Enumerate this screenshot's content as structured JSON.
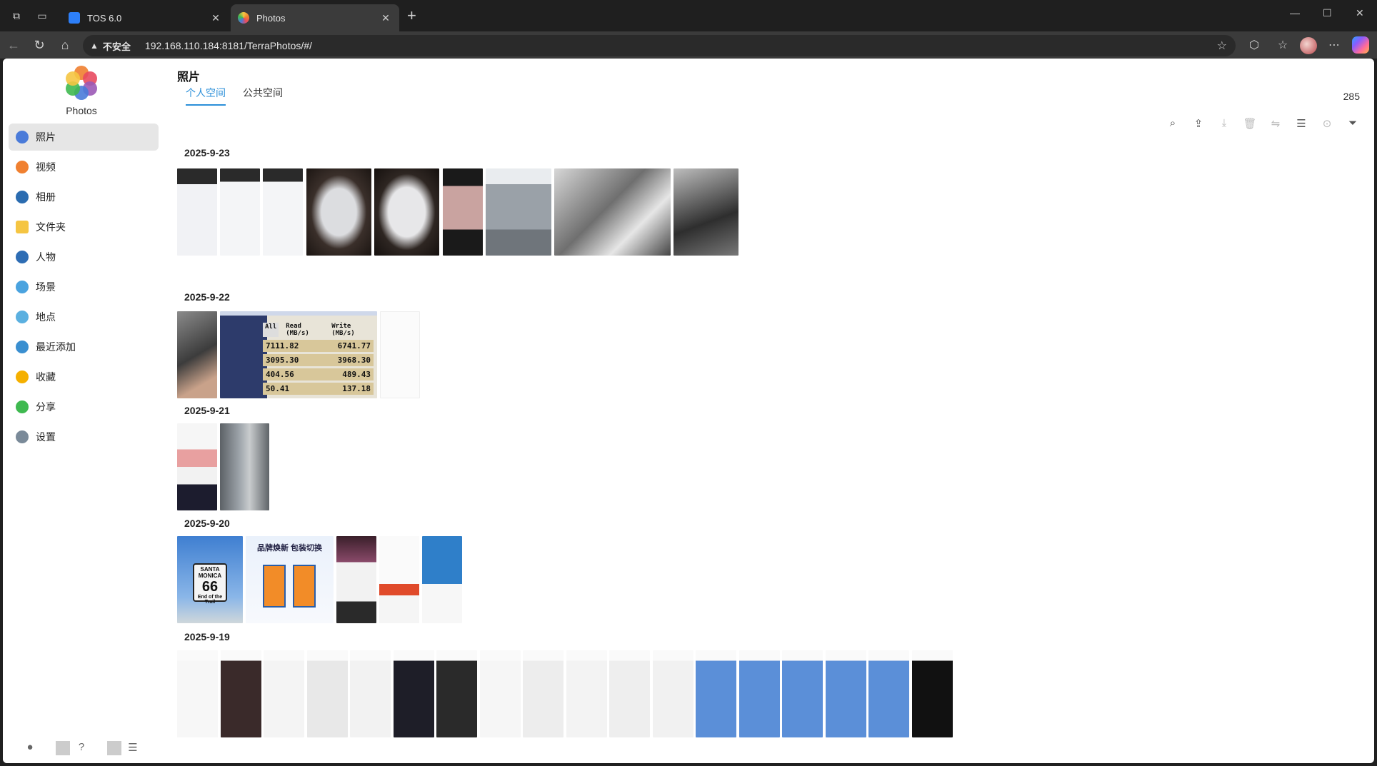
{
  "browser": {
    "tabs": [
      {
        "title": "TOS 6.0",
        "active": false,
        "favicon": "tos-icon"
      },
      {
        "title": "Photos",
        "active": true,
        "favicon": "photos-icon"
      }
    ],
    "address": {
      "security_label": "不安全",
      "url": "192.168.110.184:8181/TerraPhotos/#/"
    }
  },
  "app": {
    "logo_text": "Photos",
    "menu": [
      {
        "label": "照片",
        "icon": "photos-icon",
        "color": "#4a7bd9",
        "active": true
      },
      {
        "label": "视频",
        "icon": "video-icon",
        "color": "#f08030"
      },
      {
        "label": "相册",
        "icon": "album-icon",
        "color": "#2b6cb0"
      },
      {
        "label": "文件夹",
        "icon": "folder-icon",
        "color": "#f5c542"
      },
      {
        "label": "人物",
        "icon": "person-icon",
        "color": "#2e6db4"
      },
      {
        "label": "场景",
        "icon": "scene-icon",
        "color": "#4aa3df"
      },
      {
        "label": "地点",
        "icon": "location-icon",
        "color": "#5bb0e0"
      },
      {
        "label": "最近添加",
        "icon": "recent-icon",
        "color": "#3a8fd0"
      },
      {
        "label": "收藏",
        "icon": "star-icon",
        "color": "#f5b000"
      },
      {
        "label": "分享",
        "icon": "share-icon",
        "color": "#3fb950"
      },
      {
        "label": "设置",
        "icon": "settings-icon",
        "color": "#7a8a99"
      }
    ]
  },
  "main": {
    "title": "照片",
    "tabs": [
      {
        "label": "个人空间",
        "active": true
      },
      {
        "label": "公共空间",
        "active": false
      }
    ],
    "count": "285"
  },
  "groups": [
    {
      "date": "2025-9-23"
    },
    {
      "date": "2025-9-22"
    },
    {
      "date": "2025-9-21"
    },
    {
      "date": "2025-9-20"
    },
    {
      "date": "2025-9-19"
    }
  ],
  "thumb_text": {
    "cdm": {
      "all": "All",
      "read": "Read (MB/s)",
      "write": "Write (MB/s)",
      "rows": [
        {
          "r": "7111.82",
          "w": "6741.77"
        },
        {
          "r": "3095.30",
          "w": "3968.30"
        },
        {
          "r": "404.56",
          "w": "489.43"
        },
        {
          "r": "50.41",
          "w": "137.18"
        }
      ]
    },
    "santa": {
      "top": "SANTA MONICA",
      "num": "66",
      "bottom": "End of the Trail"
    },
    "brand": {
      "title": "品牌焕新 包装切换"
    }
  },
  "accent": "#2b8fd9"
}
